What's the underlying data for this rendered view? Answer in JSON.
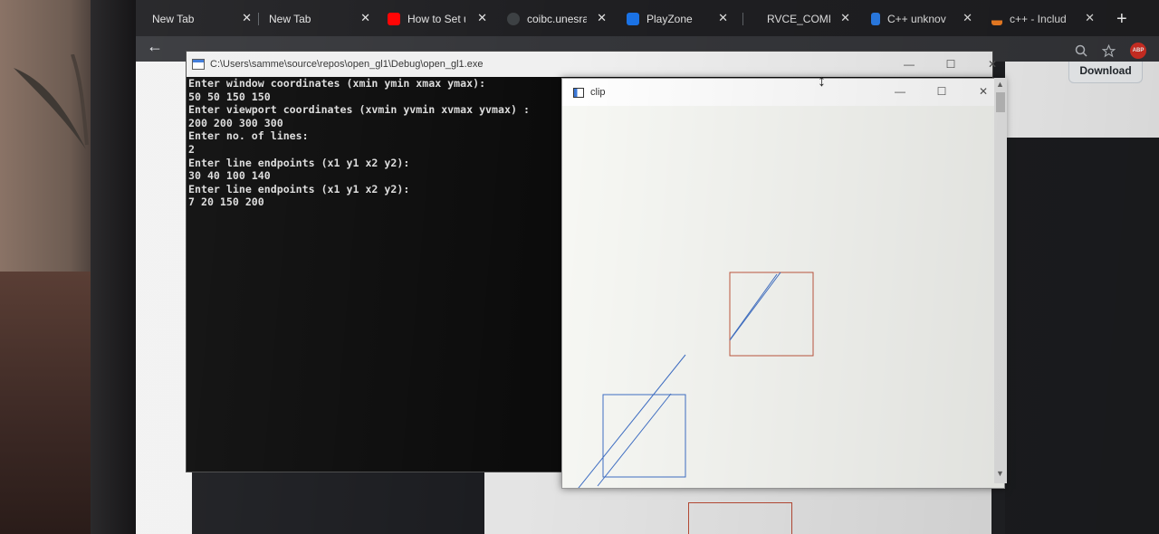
{
  "browser": {
    "tabs": [
      {
        "label": "New Tab",
        "favicon": "none"
      },
      {
        "label": "New Tab",
        "favicon": "none"
      },
      {
        "label": "How to Set u",
        "favicon": "youtube-icon",
        "favicon_color": "#ff0000"
      },
      {
        "label": "coibc.unesra",
        "favicon": "globe-icon",
        "favicon_color": "#3c4043"
      },
      {
        "label": "PlayZone",
        "favicon": "playzone-icon",
        "favicon_color": "#1a73e8"
      },
      {
        "label": "RVCE_COMPL",
        "favicon": "none"
      },
      {
        "label": "C++ unknov",
        "favicon": "bing-icon",
        "favicon_color": "#2b7de9"
      },
      {
        "label": "c++ - Includ",
        "favicon": "stackoverflow-icon",
        "favicon_color": "#f48024"
      }
    ],
    "close_glyph": "✕",
    "new_tab_glyph": "+",
    "back_glyph": "←",
    "toolbar_icons": [
      "zoom-icon",
      "star-icon",
      "adblock-icon"
    ],
    "adblock_label": "ABP"
  },
  "github": {
    "download_label": "Download"
  },
  "console": {
    "title": "C:\\Users\\samme\\source\\repos\\open_gl1\\Debug\\open_gl1.exe",
    "lines": [
      "Enter window coordinates (xmin ymin xmax ymax):",
      "50 50 150 150",
      "Enter viewport coordinates (xvmin yvmin xvmax yvmax) :",
      "200 200 300 300",
      "Enter no. of lines:",
      "2",
      "Enter line endpoints (x1 y1 x2 y2):",
      "30 40 100 140",
      "Enter line endpoints (x1 y1 x2 y2):",
      "7 20 150 200"
    ]
  },
  "glut_window": {
    "title": "clip",
    "window_color": "#3f6fc5",
    "viewport_color": "#c0573f",
    "line_color": "#3f6fc5"
  },
  "window_controls": {
    "minimize": "—",
    "maximize": "☐",
    "close": "✕"
  }
}
